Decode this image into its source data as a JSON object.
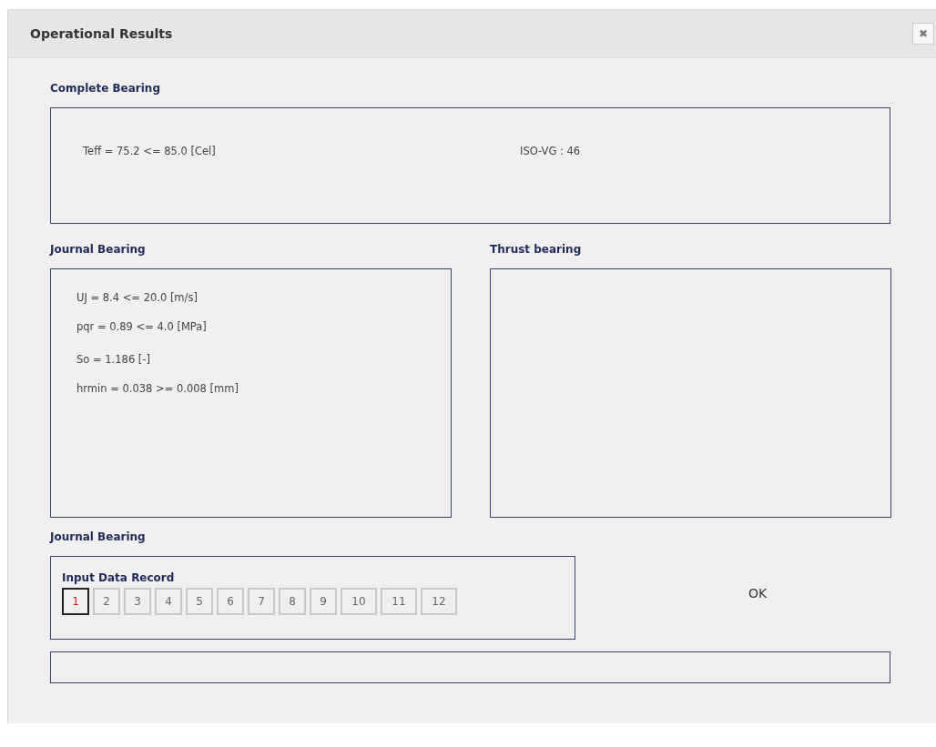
{
  "window": {
    "title": "Operational Results",
    "close": "✖"
  },
  "complete_bearing": {
    "heading": "Complete Bearing",
    "left": [
      "Teff = 75.2 <= 85.0 [Cel]"
    ],
    "right": [
      "ISO-VG : 46"
    ]
  },
  "journal_bearing": {
    "heading": "Journal Bearing",
    "groups": [
      [
        "UJ = 8.4 <= 20.0 [m/s]",
        "pqr = 0.89 <= 4.0 [MPa]"
      ],
      [
        "So = 1.186 [-]",
        "hrmin = 0.038 >= 0.008 [mm]"
      ]
    ]
  },
  "thrust_bearing": {
    "heading": "Thrust bearing"
  },
  "record_section": {
    "heading": "Journal Bearing",
    "label": "Input Data Record",
    "records": [
      {
        "label": "1",
        "selected": true
      },
      {
        "label": "2",
        "selected": false
      },
      {
        "label": "3",
        "selected": false
      },
      {
        "label": "4",
        "selected": false
      },
      {
        "label": "5",
        "selected": false
      },
      {
        "label": "6",
        "selected": false
      },
      {
        "label": "7",
        "selected": false
      },
      {
        "label": "8",
        "selected": false
      },
      {
        "label": "9",
        "selected": false
      },
      {
        "label": "10",
        "selected": false
      },
      {
        "label": "11",
        "selected": false
      },
      {
        "label": "12",
        "selected": false
      }
    ]
  },
  "ok_button": "OK"
}
